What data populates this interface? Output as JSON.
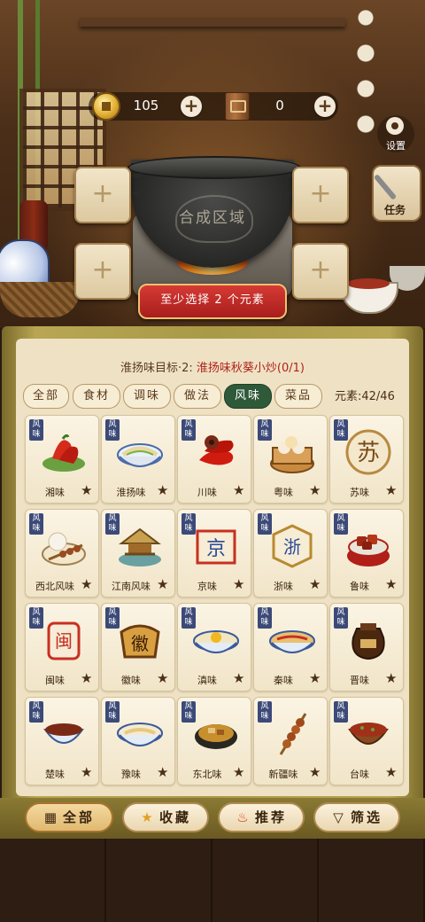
{
  "currency": {
    "coins": "105",
    "books": "0"
  },
  "side": {
    "settings_label": "设置",
    "task_label": "任务"
  },
  "synth": {
    "area_label": "合成区域",
    "slot_glyph": "+",
    "hint": "至少选择 2 个元素"
  },
  "panel": {
    "target_prefix": "淮扬味目标·2: ",
    "target_dish": "淮扬味秋葵小炒(0/1)",
    "tabs": [
      "全部",
      "食材",
      "调味",
      "做法",
      "风味",
      "菜品"
    ],
    "active_tab": "风味",
    "element_count": "元素:42/46",
    "tag_text": "风味",
    "items": [
      {
        "name": "湘味",
        "icon": "red-chili-icon"
      },
      {
        "name": "淮扬味",
        "icon": "noodle-bowl-icon"
      },
      {
        "name": "川味",
        "icon": "chili-pepper-icon"
      },
      {
        "name": "粤味",
        "icon": "dim-sum-steamer-icon"
      },
      {
        "name": "苏味",
        "icon": "su-badge-icon"
      },
      {
        "name": "西北风味",
        "icon": "kebab-bun-icon"
      },
      {
        "name": "江南风味",
        "icon": "pavilion-icon"
      },
      {
        "name": "京味",
        "icon": "jing-scroll-icon"
      },
      {
        "name": "浙味",
        "icon": "zhe-badge-icon"
      },
      {
        "name": "鲁味",
        "icon": "braised-pork-icon"
      },
      {
        "name": "闽味",
        "icon": "min-tag-icon"
      },
      {
        "name": "徽味",
        "icon": "hui-tag-icon"
      },
      {
        "name": "滇味",
        "icon": "rice-noodle-bowl-icon"
      },
      {
        "name": "秦味",
        "icon": "biangbiang-noodle-icon"
      },
      {
        "name": "晋味",
        "icon": "vinegar-jar-icon"
      },
      {
        "name": "楚味",
        "icon": "sauce-bowl-icon"
      },
      {
        "name": "豫味",
        "icon": "hui-noodle-bowl-icon"
      },
      {
        "name": "东北味",
        "icon": "stew-pot-icon"
      },
      {
        "name": "新疆味",
        "icon": "lamb-skewer-icon"
      },
      {
        "name": "台味",
        "icon": "braised-rice-icon"
      }
    ],
    "star_glyph": "★"
  },
  "bottom": {
    "all": "全部",
    "favorites": "收藏",
    "recommend": "推荐",
    "filter": "筛选"
  },
  "colors": {
    "active_tab": "#2f5a3a",
    "hint_bg": "#c42c28",
    "tag_bg": "#3c4a78",
    "panel_bg": "#efe2c4"
  }
}
